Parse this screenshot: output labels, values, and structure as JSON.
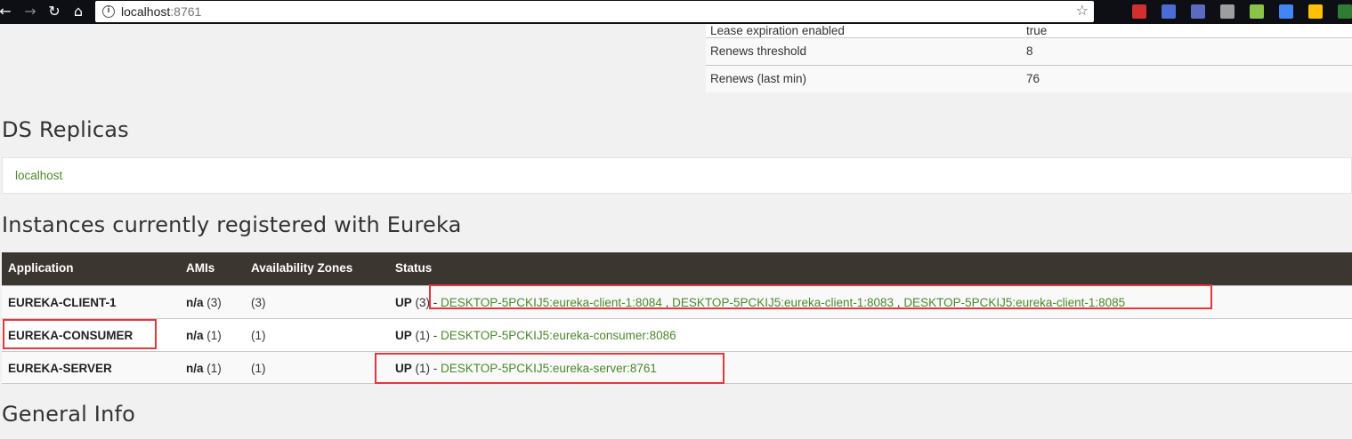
{
  "browser": {
    "url_host": "localhost",
    "url_port": ":8761",
    "back_icon": "arrow-left-icon",
    "forward_icon": "arrow-right-icon",
    "reload_icon": "reload-icon",
    "home_icon": "home-icon",
    "bookmark_icon": "star-icon",
    "extensions": [
      {
        "name": "fe-extension-icon",
        "color": "#d32f2f"
      },
      {
        "name": "translate-extension-icon",
        "color": "#4a6cd4"
      },
      {
        "name": "jh-extension-icon",
        "color": "#5c6bc0"
      },
      {
        "name": "vue-extension-icon",
        "color": "#9e9e9e"
      },
      {
        "name": "green-dot-extension-icon",
        "color": "#8bc34a"
      },
      {
        "name": "google-translate-extension-icon",
        "color": "#4285f4"
      },
      {
        "name": "clock-extension-icon",
        "color": "#ffc107"
      },
      {
        "name": "chrome-extension-icon",
        "color": "#2e7d32"
      }
    ]
  },
  "stats": [
    {
      "label": "Lease expiration enabled",
      "value": "true"
    },
    {
      "label": "Renews threshold",
      "value": "8"
    },
    {
      "label": "Renews (last min)",
      "value": "76"
    }
  ],
  "ds_replicas": {
    "title": "DS Replicas",
    "host": "localhost"
  },
  "instances": {
    "title": "Instances currently registered with Eureka",
    "columns": [
      "Application",
      "AMIs",
      "Availability Zones",
      "Status"
    ],
    "rows": [
      {
        "application": "EUREKA-CLIENT-1",
        "ami_label": "n/a",
        "ami_count": "(3)",
        "zones": "(3)",
        "status_label": "UP",
        "status_count": "(3)",
        "sep": " - ",
        "links": [
          "DESKTOP-5PCKIJ5:eureka-client-1:8084",
          "DESKTOP-5PCKIJ5:eureka-client-1:8083",
          "DESKTOP-5PCKIJ5:eureka-client-1:8085"
        ]
      },
      {
        "application": "EUREKA-CONSUMER",
        "ami_label": "n/a",
        "ami_count": "(1)",
        "zones": "(1)",
        "status_label": "UP",
        "status_count": "(1)",
        "sep": " - ",
        "links": [
          "DESKTOP-5PCKIJ5:eureka-consumer:8086"
        ]
      },
      {
        "application": "EUREKA-SERVER",
        "ami_label": "n/a",
        "ami_count": "(1)",
        "zones": "(1)",
        "status_label": "UP",
        "status_count": "(1)",
        "sep": " - ",
        "links": [
          "DESKTOP-5PCKIJ5:eureka-server:8761"
        ]
      }
    ],
    "link_separator": " , "
  },
  "general_info": {
    "title": "General Info"
  },
  "colors": {
    "link": "#4a8a2b",
    "table_header": "#3c3631",
    "highlight": "#e0383e"
  }
}
